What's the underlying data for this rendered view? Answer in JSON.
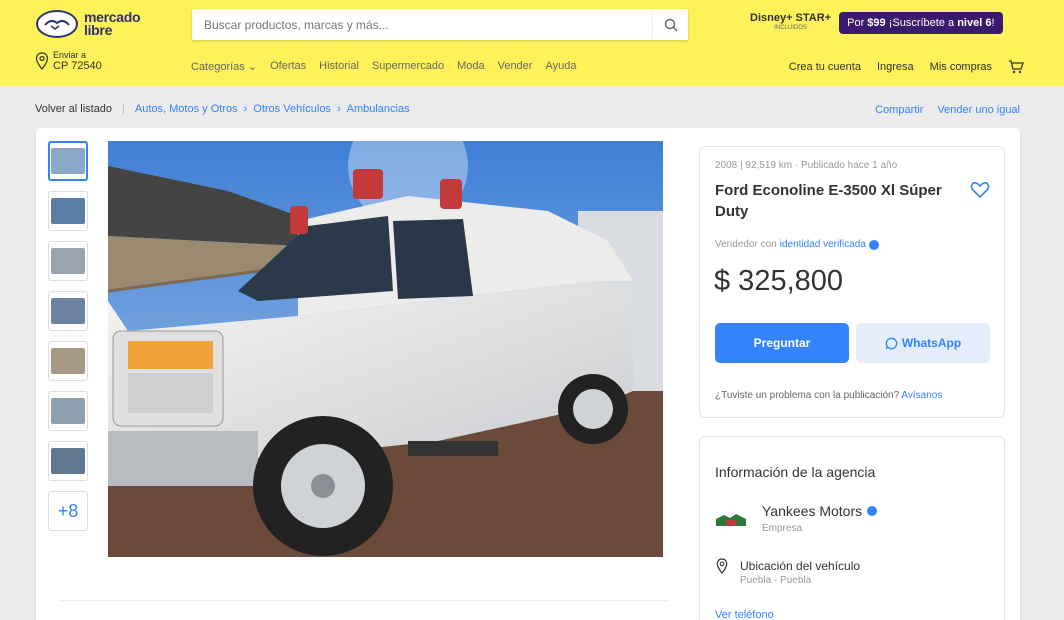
{
  "header": {
    "logo": {
      "line1": "mercado",
      "line2": "libre"
    },
    "search": {
      "placeholder": "Buscar productos, marcas y más..."
    },
    "promo": {
      "disney_label": "Disney+ STAR+",
      "disney_sub": "INCLUIDOS",
      "button_prefix": "Por ",
      "button_price": "$99",
      "button_text": " ¡Suscríbete a ",
      "button_level": "nivel 6",
      "button_suffix": "!"
    },
    "location": {
      "line1": "Enviar a",
      "line2": "CP 72540"
    },
    "nav": [
      "Categorías ⌄",
      "Ofertas",
      "Historial",
      "Supermercado",
      "Moda",
      "Vender",
      "Ayuda"
    ],
    "user_nav": [
      "Crea tu cuenta",
      "Ingresa",
      "Mis compras"
    ]
  },
  "breadcrumb": {
    "back": "Volver al listado",
    "path": [
      "Autos, Motos y Otros",
      "Otros Vehículos",
      "Ambulancias"
    ],
    "separator": "›",
    "right": [
      "Compartir",
      "Vender uno igual"
    ]
  },
  "gallery": {
    "thumb_count": 7,
    "more_label": "+8",
    "thumb_colors": [
      "#8aa8c8",
      "#5a7ea8",
      "#9aa4ae",
      "#6d84a0",
      "#a89a86",
      "#8fa0b0",
      "#607890"
    ]
  },
  "listing": {
    "meta": "2008 | 92,519 km · Publicado hace 1 año",
    "title": "Ford Econoline E-3500 Xl Súper Duty",
    "seller_prefix": "Vendedor con ",
    "seller_link": "identidad verificada",
    "price": "$ 325,800",
    "ask_button": "Preguntar",
    "whatsapp_button": "WhatsApp",
    "problem_text": "¿Tuviste un problema con la publicación? ",
    "problem_link": "Avísanos"
  },
  "agency": {
    "title": "Información de la agencia",
    "name": "Yankees Motors",
    "type": "Empresa",
    "location_label": "Ubicación del vehículo",
    "location_city": "Puebla - Puebla",
    "phone_link": "Ver teléfono"
  },
  "colors": {
    "brand_yellow": "#fff159",
    "accent_blue": "#3483fa",
    "promo_purple": "#3b1a6e"
  }
}
